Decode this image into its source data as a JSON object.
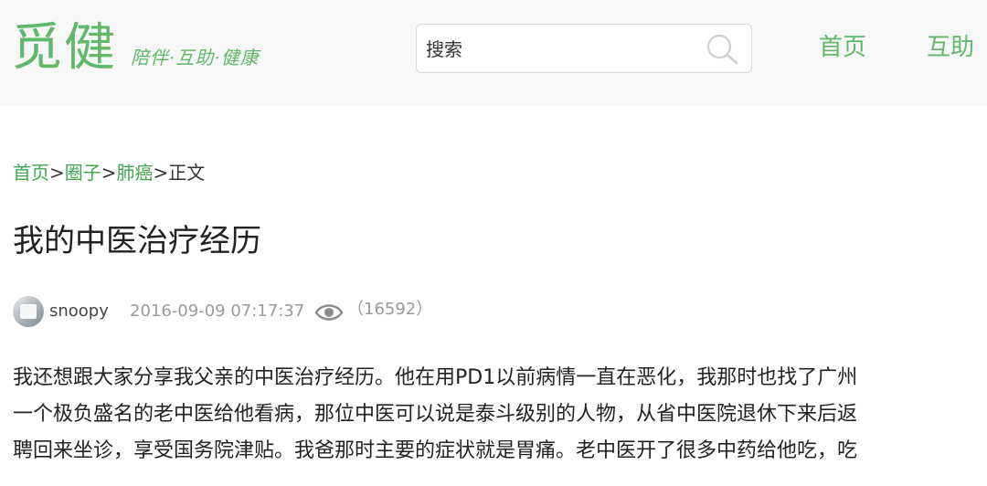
{
  "header": {
    "logo": "觅健",
    "slogan": "陪伴·互助·健康",
    "search": {
      "placeholder": "搜索",
      "value": ""
    },
    "nav": [
      {
        "label": "首页"
      },
      {
        "label": "互助"
      }
    ]
  },
  "breadcrumb": {
    "items": [
      "首页",
      "圈子",
      "肺癌"
    ],
    "separator": ">",
    "current": "正文"
  },
  "post": {
    "title": "我的中医治疗经历",
    "author": "snoopy",
    "timestamp": "2016-09-09 07:17:37",
    "views": "（16592）",
    "body_lines": [
      "我还想跟大家分享我父亲的中医治疗经历。他在用PD1以前病情一直在恶化，我那时也找了广州",
      "一个极负盛名的老中医给他看病，那位中医可以说是泰斗级别的人物，从省中医院退休下来后返",
      "聘回来坐诊，享受国务院津贴。我爸那时主要的症状就是胃痛。老中医开了很多中药给他吃，吃"
    ]
  },
  "colors": {
    "brand_green": "#62b86a",
    "link_green": "#3fa84d",
    "header_bg": "#f7f7f7",
    "meta_gray": "#9a9a9a"
  },
  "icons": {
    "search": "search-icon",
    "views": "eye-icon"
  }
}
